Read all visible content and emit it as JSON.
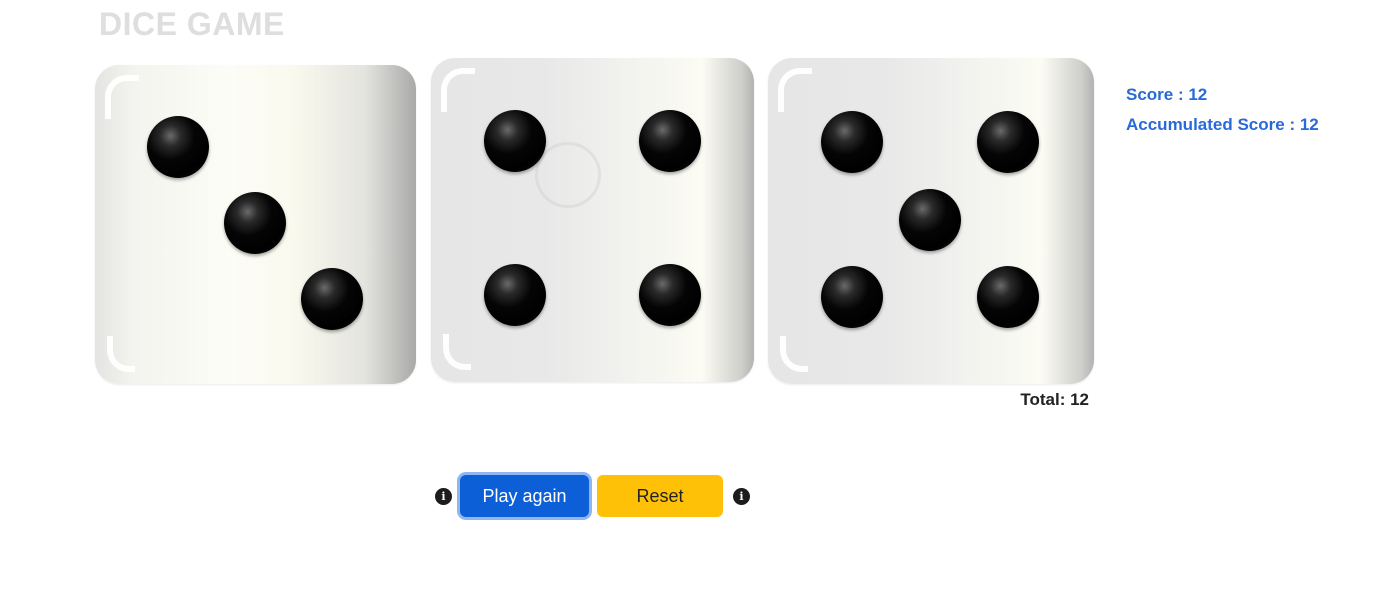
{
  "header": {
    "title": "DICE GAME"
  },
  "dice": [
    {
      "value": 3
    },
    {
      "value": 4
    },
    {
      "value": 5
    }
  ],
  "scores": {
    "score_label": "Score : 12",
    "accumulated_label": "Accumulated Score : 12"
  },
  "total": {
    "label": "Total: 12"
  },
  "controls": {
    "play_again_label": "Play again",
    "reset_label": "Reset",
    "info_icon_glyph": "i"
  },
  "colors": {
    "accent_blue": "#0d5fd8",
    "score_text": "#2a6ad8",
    "reset_yellow": "#ffc107",
    "title_gray": "#dedede"
  }
}
